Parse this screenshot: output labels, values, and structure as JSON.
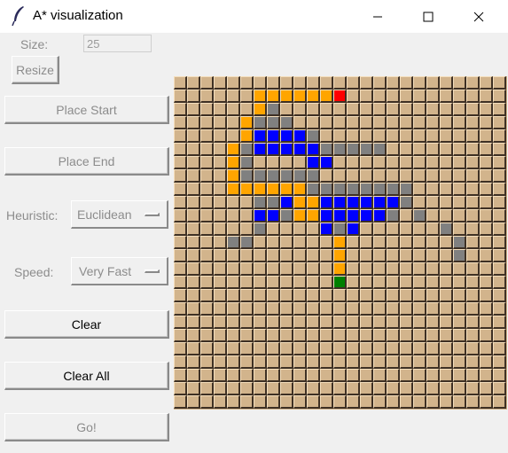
{
  "window": {
    "title": "A* visualization"
  },
  "size": {
    "label": "Size:",
    "value": "25",
    "resize_label": "Resize"
  },
  "buttons": {
    "place_start": "Place Start",
    "place_end": "Place End",
    "clear": "Clear",
    "clear_all": "Clear All",
    "go": "Go!"
  },
  "heuristic": {
    "label": "Heuristic:",
    "selected": "Euclidean"
  },
  "speed": {
    "label": "Speed:",
    "selected": "Very Fast"
  },
  "colors": {
    "empty": "#d2b48c",
    "wall": "#808080",
    "path": "#ffa500",
    "visited": "#0000ff",
    "start": "#ff0000",
    "end": "#008000"
  },
  "grid": {
    "size": 25,
    "legend": "E=empty W=wall P=path V=visited S=start G=end",
    "rows": [
      "EEEEEEEEEEEEEEEEEEEEEEEEE",
      "EEEEEEPPPPPPSEEEEEEEEEEEE",
      "EEEEEEPWEEEEEEEEEEEEEEEEE",
      "EEEEEPWWWEEEEEEEEEEEEEEEE",
      "EEEEEPVVVVWEEEEEEEEEEEEEE",
      "EEEEPWVVVVVWWWWWEEEEEEEEE",
      "EEEEPWEEEEVVEEEEEEEEEEEEE",
      "EEEEPWWWWWWEEEEEEEEEEEEEE",
      "EEEEPPPPPPWWWWWWWWEEEEEEE",
      "EEEEEEWWVPPVVVVVVWEEEEEEE",
      "EEEEEEVVWPPVVVVVWEWEEEEEE",
      "EEEEEEWEEEEVWVEEEEEEWEEEE",
      "EEEEWWEEEEEEPEEEEEEEEWEEE",
      "EEEEEEEEEEEEPEEEEEEEEWEEE",
      "EEEEEEEEEEEEPEEEEEEEEEEEE",
      "EEEEEEEEEEEEGEEEEEEEEEEEE",
      "EEEEEEEEEEEEEEEEEEEEEEEEE",
      "EEEEEEEEEEEEEEEEEEEEEEEEE",
      "EEEEEEEEEEEEEEEEEEEEEEEEE",
      "EEEEEEEEEEEEEEEEEEEEEEEEE",
      "EEEEEEEEEEEEEEEEEEEEEEEEE",
      "EEEEEEEEEEEEEEEEEEEEEEEEE",
      "EEEEEEEEEEEEEEEEEEEEEEEEE",
      "EEEEEEEEEEEEEEEEEEEEEEEEE",
      "EEEEEEEEEEEEEEEEEEEEEEEEE"
    ]
  }
}
